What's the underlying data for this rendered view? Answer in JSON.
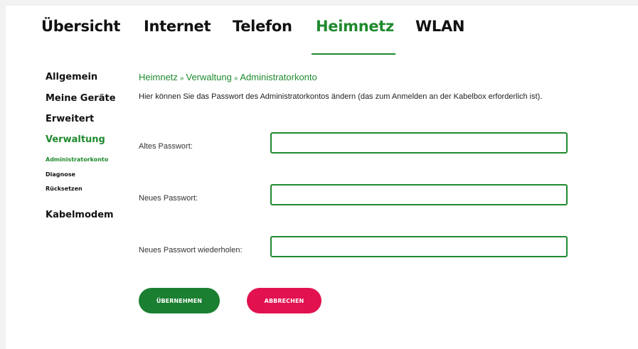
{
  "topnav": {
    "tabs": [
      {
        "label": "Übersicht"
      },
      {
        "label": "Internet"
      },
      {
        "label": "Telefon"
      },
      {
        "label": "Heimnetz",
        "active": true
      },
      {
        "label": "WLAN"
      }
    ]
  },
  "sidebar": {
    "items": [
      {
        "label": "Allgemein"
      },
      {
        "label": "Meine Geräte"
      },
      {
        "label": "Erweitert"
      },
      {
        "label": "Verwaltung",
        "active": true
      },
      {
        "label": "Kabelmodem"
      }
    ],
    "subitems": [
      {
        "label": "Administratorkonto",
        "active": true
      },
      {
        "label": "Diagnose"
      },
      {
        "label": "Rücksetzen"
      }
    ]
  },
  "breadcrumb": {
    "items": [
      "Heimnetz",
      "Verwaltung",
      "Administratorkonto"
    ],
    "separator": "»"
  },
  "description": "Hier können Sie das Passwort des Administratorkontos ändern (das zum Anmelden an der Kabelbox erforderlich ist).",
  "form": {
    "old_password": {
      "label": "Altes Passwort:",
      "value": ""
    },
    "new_password": {
      "label": "Neues Passwort:",
      "value": ""
    },
    "repeat_password": {
      "label": "Neues Passwort wiederholen:",
      "value": ""
    }
  },
  "buttons": {
    "save": "ÜBERNEHMEN",
    "cancel": "ABBRECHEN"
  },
  "colors": {
    "accent_green": "#1f8a2e",
    "button_green": "#1a7f31",
    "button_red": "#e2114f"
  }
}
